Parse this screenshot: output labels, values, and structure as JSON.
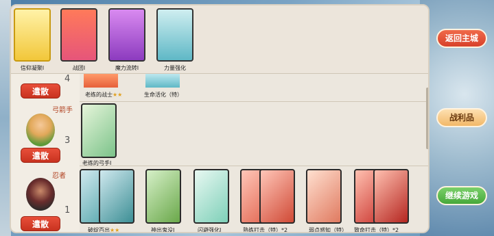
{
  "top_cards": [
    {
      "label": "信仰凝聚I",
      "color": "#f2c73a"
    },
    {
      "label": "战团I",
      "color": "#e6557a"
    },
    {
      "label": "魔力流转I",
      "color": "#b45be0"
    },
    {
      "label": "力量强化",
      "color": "#5fb8c6"
    }
  ],
  "rows": [
    {
      "role": "",
      "count": "4",
      "button": "遣散",
      "cards": [
        {
          "label": "老练的战士",
          "stars": "★★"
        },
        {
          "label": "生命活化（特）",
          "stars": ""
        }
      ]
    },
    {
      "role": "弓箭手",
      "count": "3",
      "button": "遣散",
      "cards": [
        {
          "label": "老练的弓手I",
          "stars": ""
        }
      ]
    },
    {
      "role": "忍者",
      "count": "1",
      "button": "遣散",
      "cards": [
        {
          "label": "破绽百出",
          "stars": "★★"
        },
        {
          "label": "神出鬼没I",
          "stars": ""
        },
        {
          "label": "闪避强化I",
          "stars": ""
        },
        {
          "label": "熟练打击（特）*2",
          "stars": ""
        },
        {
          "label": "弱点感知（特）",
          "stars": ""
        },
        {
          "label": "致命打击（特）*2",
          "stars": ""
        }
      ]
    }
  ],
  "side_buttons": {
    "return_city": "返回主城",
    "loot": "战利品",
    "continue": "继续游戏"
  }
}
